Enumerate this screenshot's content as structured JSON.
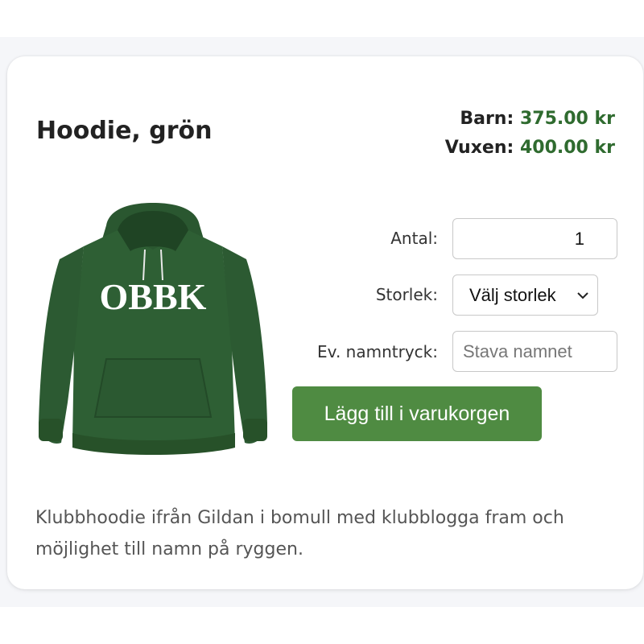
{
  "product": {
    "title": "Hoodie, grön",
    "image_alt": "Grön hoodie med OBBK-tryck",
    "print_text": "OBBK",
    "description": "Klubbhoodie ifrån Gildan i bomull med klubblogga fram och möjlighet till namn på ryggen."
  },
  "prices": [
    {
      "label": "Barn:",
      "value": "375.00 kr"
    },
    {
      "label": "Vuxen:",
      "value": "400.00 kr"
    }
  ],
  "form": {
    "quantity_label": "Antal:",
    "quantity_value": "1",
    "size_label": "Storlek:",
    "size_selected": "Välj storlek",
    "name_label": "Ev. namntryck:",
    "name_placeholder": "Stava namnet",
    "add_button_label": "Lägg till i varukorgen"
  },
  "colors": {
    "price_green": "#2f6b2f",
    "button_green": "#4f8b42",
    "hoodie_green": "#2e5f34"
  },
  "icons": {
    "size_dropdown": "chevron-down-icon"
  }
}
